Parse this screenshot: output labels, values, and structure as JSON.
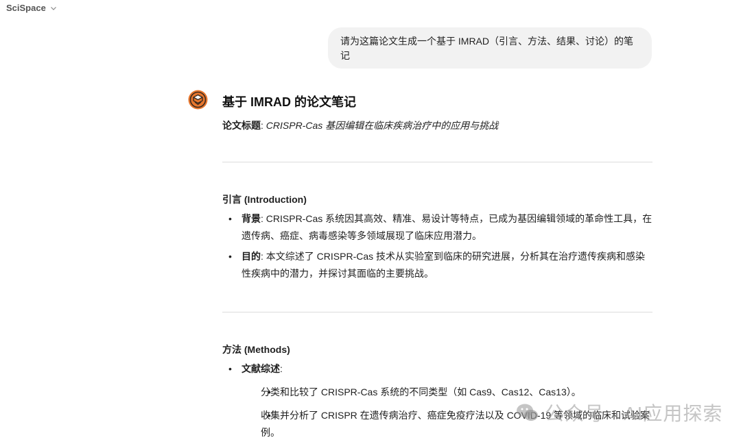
{
  "app": {
    "name": "SciSpace"
  },
  "user_message": "请为这篇论文生成一个基于 IMRAD（引言、方法、结果、讨论）的笔记",
  "response": {
    "heading": "基于 IMRAD 的论文笔记",
    "title_label": "论文标题",
    "title_value": "CRISPR-Cas 基因编辑在临床疾病治疗中的应用与挑战",
    "introduction": {
      "heading": "引言 (Introduction)",
      "items": [
        {
          "label": "背景",
          "text": "CRISPR-Cas 系统因其高效、精准、易设计等特点，已成为基因编辑领域的革命性工具，在遗传病、癌症、病毒感染等多领域展现了临床应用潜力。"
        },
        {
          "label": "目的",
          "text": "本文综述了 CRISPR-Cas 技术从实验室到临床的研究进展，分析其在治疗遗传疾病和感染性疾病中的潜力，并探讨其面临的主要挑战。"
        }
      ]
    },
    "methods": {
      "heading": "方法 (Methods)",
      "item_label": "文献综述",
      "subitems": [
        "分类和比较了 CRISPR-Cas 系统的不同类型（如 Cas9、Cas12、Cas13）。",
        "收集并分析了 CRISPR 在遗传病治疗、癌症免疫疗法以及 COVID-19 等领域的临床和试验案例。"
      ]
    }
  },
  "watermark": "公众号 · AI应用探索",
  "colors": {
    "avatar": "#e8772e",
    "bubble": "#f2f2f2",
    "divider": "#dcdcdc"
  }
}
